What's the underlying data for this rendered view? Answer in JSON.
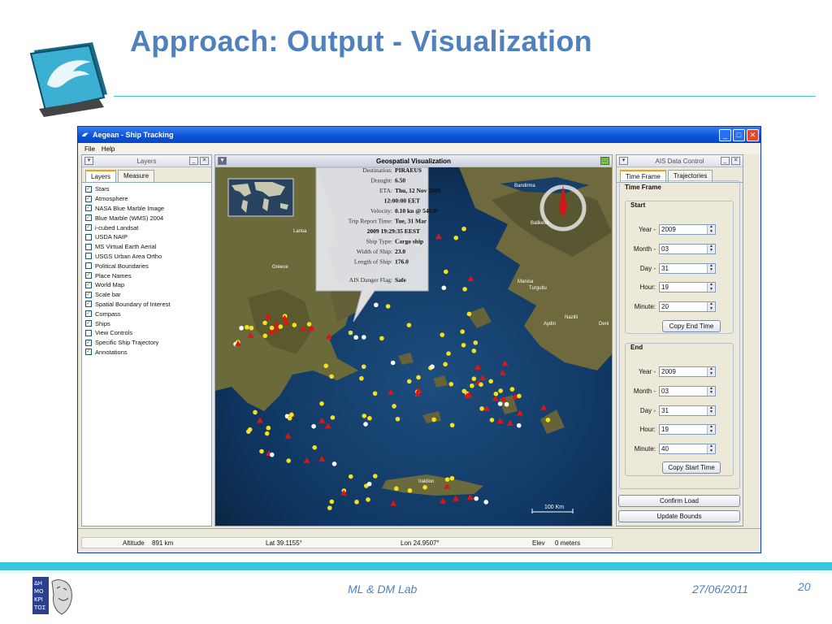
{
  "slide": {
    "title": "Approach: Output - Visualization",
    "footer_lab": "ML & DM Lab",
    "footer_date": "27/06/2011",
    "page_number": "20",
    "colors": {
      "title": "#4f81bd",
      "accent": "#37c6df"
    }
  },
  "window": {
    "title": "Aegean - Ship Tracking",
    "menu": [
      "File",
      "Help"
    ],
    "controls": [
      "minimize-icon",
      "maximize-icon",
      "close-icon"
    ]
  },
  "layers_panel": {
    "title": "Layers",
    "tabs": [
      "Layers",
      "Measure"
    ],
    "items": [
      {
        "label": "Stars",
        "checked": true
      },
      {
        "label": "Atmosphere",
        "checked": true
      },
      {
        "label": "NASA Blue Marble Image",
        "checked": true
      },
      {
        "label": "Blue Marble (WMS) 2004",
        "checked": true
      },
      {
        "label": "i-cubed Landsat",
        "checked": true
      },
      {
        "label": "USDA NAIP",
        "checked": false
      },
      {
        "label": "MS Virtual Earth Aerial",
        "checked": false
      },
      {
        "label": "USGS Urban Area Ortho",
        "checked": false
      },
      {
        "label": "Political Boundaries",
        "checked": false
      },
      {
        "label": "Place Names",
        "checked": true
      },
      {
        "label": "World Map",
        "checked": true
      },
      {
        "label": "Scale bar",
        "checked": true
      },
      {
        "label": "Spatial Boundary of Interest",
        "checked": true
      },
      {
        "label": "Compass",
        "checked": true
      },
      {
        "label": "Ships",
        "checked": true
      },
      {
        "label": "View Controls",
        "checked": false
      },
      {
        "label": "Specific Ship Trajectory",
        "checked": true
      },
      {
        "label": "Annotations",
        "checked": true
      }
    ]
  },
  "geo_panel": {
    "title": "Geospatial Visualization",
    "scale_label": "100 Km",
    "place_names": [
      "Bandirma",
      "Balikesir",
      "Larisa",
      "Greece",
      "Manisa",
      "Turgutlu",
      "Nazilli",
      "Aydin",
      "Deni",
      "Iraklion"
    ],
    "popup": {
      "lines": [
        {
          "label": "Destination:",
          "value": "PIRAEUS"
        },
        {
          "label": "Draught:",
          "value": "6.50"
        },
        {
          "label": "ETA:",
          "value": "Thu, 12 Nov 2009"
        },
        {
          "label": "",
          "value": "12:00:00 EET"
        },
        {
          "label": "Velocity:",
          "value": "0.10 kn @ 540.0°"
        },
        {
          "label": "Trip Report Time:",
          "value": "Tue, 31 Mar"
        },
        {
          "label": "",
          "value": "2009 19:29:35 EEST"
        },
        {
          "label": "Ship Type:",
          "value": "Cargo ship"
        },
        {
          "label": "Width of Ship:",
          "value": "23.0"
        },
        {
          "label": "Length of Ship:",
          "value": "176.0"
        },
        {
          "label": "AIS Danger Flag:",
          "value": "Safe"
        }
      ]
    }
  },
  "ais_panel": {
    "title": "AIS Data Control",
    "tabs": [
      "Time Frame",
      "Trajectories"
    ],
    "section": "Time Frame",
    "start": {
      "label": "Start",
      "fields": [
        {
          "label": "Year -",
          "value": "2009"
        },
        {
          "label": "Month -",
          "value": "03"
        },
        {
          "label": "Day -",
          "value": "31"
        },
        {
          "label": "Hour:",
          "value": "19"
        },
        {
          "label": "Minute:",
          "value": "20"
        }
      ],
      "button": "Copy End Time"
    },
    "end": {
      "label": "End",
      "fields": [
        {
          "label": "Year -",
          "value": "2009"
        },
        {
          "label": "Month -",
          "value": "03"
        },
        {
          "label": "Day -",
          "value": "31"
        },
        {
          "label": "Hour:",
          "value": "19"
        },
        {
          "label": "Minute:",
          "value": "40"
        }
      ],
      "button": "Copy Start Time"
    },
    "confirm_button": "Confirm Load",
    "update_button": "Update Bounds"
  },
  "status": {
    "altitude_label": "Altitude",
    "altitude_value": "891 km",
    "lat": "Lat 39.1155°",
    "lon": "Lon 24.9507°",
    "elev_label": "Elev",
    "elev_value": "0 meters"
  }
}
